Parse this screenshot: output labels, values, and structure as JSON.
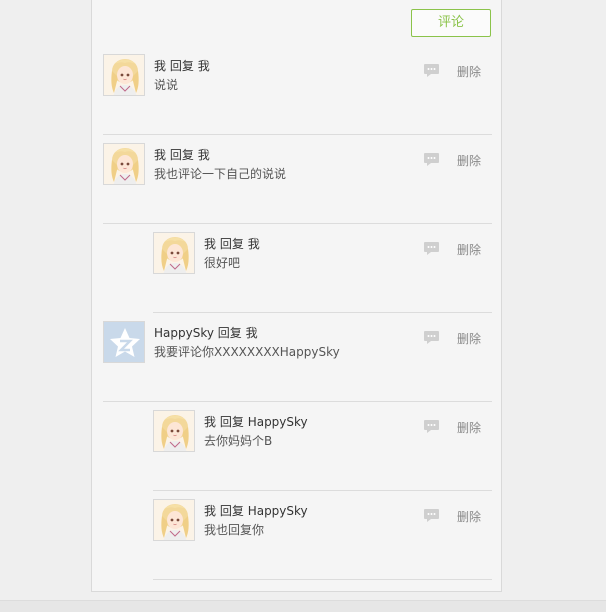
{
  "actions": {
    "comment_button": "评论"
  },
  "comments": [
    {
      "author": "我",
      "reply_word": "回复",
      "target": "我",
      "text": "说说",
      "avatar": "anime-girl-avatar",
      "delete_label": "删除"
    },
    {
      "author": "我",
      "reply_word": "回复",
      "target": "我",
      "text": "我也评论一下自己的说说",
      "avatar": "anime-girl-avatar",
      "delete_label": "删除"
    },
    {
      "author": "我",
      "reply_word": "回复",
      "target": "我",
      "text": "很好吧",
      "avatar": "anime-girl-avatar",
      "delete_label": "删除"
    },
    {
      "author": "HappySky",
      "reply_word": "回复",
      "target": "我",
      "text": "我要评论你XXXXXXXXHappySky",
      "avatar": "default-qzone-avatar",
      "delete_label": "删除"
    },
    {
      "author": "我",
      "reply_word": "回复",
      "target": "HappySky",
      "text": "去你妈妈个B",
      "avatar": "anime-girl-avatar",
      "delete_label": "删除"
    },
    {
      "author": "我",
      "reply_word": "回复",
      "target": "HappySky",
      "text": "我也回复你",
      "avatar": "anime-girl-avatar",
      "delete_label": "删除"
    }
  ],
  "colors": {
    "accent": "#8bc34a",
    "default_avatar": "#c9d9ea"
  },
  "icons": {
    "reply": "speech-bubble-icon"
  }
}
